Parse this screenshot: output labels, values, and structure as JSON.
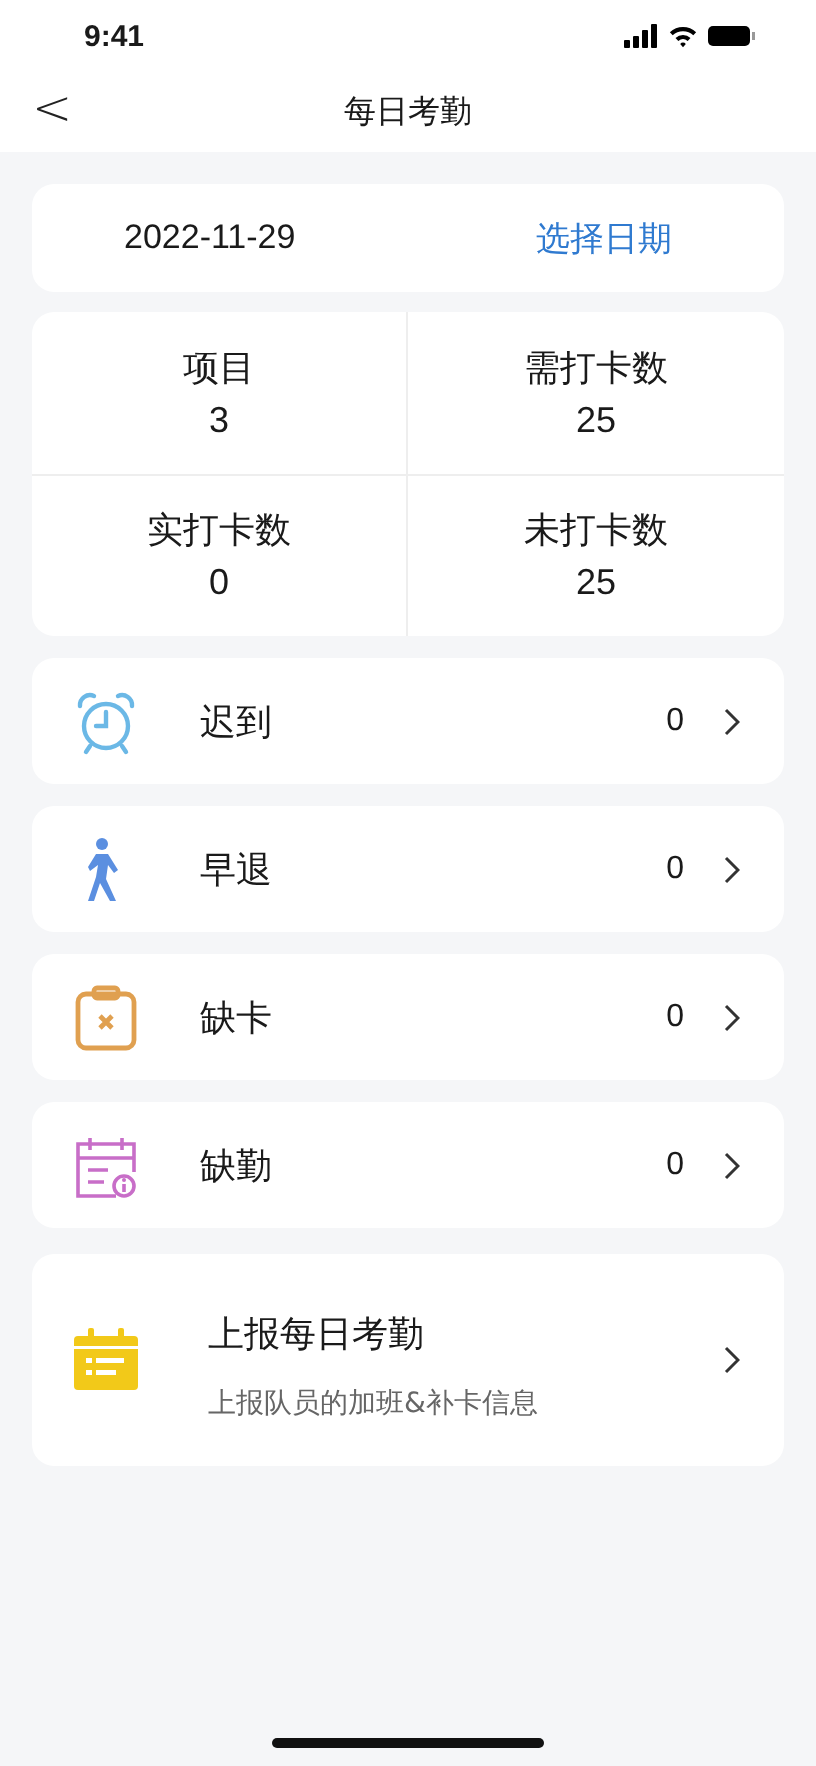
{
  "status_bar": {
    "time": "9:41"
  },
  "header": {
    "back": "<",
    "title": "每日考勤"
  },
  "date_card": {
    "date": "2022-11-29",
    "action": "选择日期"
  },
  "stats": [
    {
      "label": "项目",
      "value": "3"
    },
    {
      "label": "需打卡数",
      "value": "25"
    },
    {
      "label": "实打卡数",
      "value": "0"
    },
    {
      "label": "未打卡数",
      "value": "25"
    }
  ],
  "items": [
    {
      "kind": "alarm",
      "label": "迟到",
      "count": "0"
    },
    {
      "kind": "walk",
      "label": "早退",
      "count": "0"
    },
    {
      "kind": "clipboard",
      "label": "缺卡",
      "count": "0"
    },
    {
      "kind": "calendar",
      "label": "缺勤",
      "count": "0"
    }
  ],
  "report": {
    "title": "上报每日考勤",
    "subtitle": "上报队员的加班&补卡信息"
  }
}
